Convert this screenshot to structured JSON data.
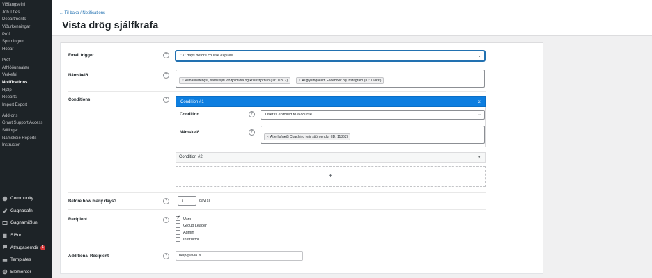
{
  "sidebar": {
    "submenu": [
      {
        "label": "Viðfangsefni",
        "active": false
      },
      {
        "label": "Job Titles",
        "active": false
      },
      {
        "label": "Departments",
        "active": false
      },
      {
        "label": "Viðurkenningar",
        "active": false
      },
      {
        "label": "Próf",
        "active": false
      },
      {
        "label": "Spurningum",
        "active": false
      },
      {
        "label": "Hópar",
        "active": false
      },
      {
        "label": "",
        "active": false
      },
      {
        "label": "Próf",
        "active": false
      },
      {
        "label": "Afhlöðunnalær",
        "active": false
      },
      {
        "label": "Verkefni",
        "active": false
      },
      {
        "label": "Notifications",
        "active": true
      },
      {
        "label": "Hjálp",
        "active": false
      },
      {
        "label": "Reports",
        "active": false
      },
      {
        "label": "Import Export",
        "active": false
      },
      {
        "label": "",
        "active": false
      },
      {
        "label": "Add-ons",
        "active": false
      },
      {
        "label": "Grant Support Access",
        "active": false
      },
      {
        "label": "Stillingar",
        "active": false
      },
      {
        "label": "Námskeið Reports",
        "active": false
      },
      {
        "label": "Instructor",
        "active": false
      }
    ],
    "menu": [
      {
        "label": "Community",
        "icon": "community-icon"
      },
      {
        "label": "Gagnasafn",
        "icon": "pin-icon"
      },
      {
        "label": "Gagnamiðlun",
        "icon": "media-icon"
      },
      {
        "label": "Síður",
        "icon": "page-icon"
      },
      {
        "label": "Athugasemdir",
        "icon": "comment-icon",
        "badge": "1"
      },
      {
        "label": "Templates",
        "icon": "folder-icon"
      },
      {
        "label": "Elementor",
        "icon": "elementor-icon"
      }
    ]
  },
  "header": {
    "back_link": "← Til baka / Notifications",
    "title": "Vista drög sjálfkrafa"
  },
  "form": {
    "help_glyph": "?",
    "email_trigger": {
      "label": "Email trigger",
      "value": "\"X\" days before course expires"
    },
    "courses": {
      "label": "Námskeið",
      "tags": [
        "Almannatengsl, samskipti við fjölmiðla og krísustjórnun (ID: 11872)",
        "Auglýsingakerfi Facebook og Instagram (ID: 11866)"
      ]
    },
    "conditions": {
      "label": "Conditions",
      "condition1": {
        "title": "Condition #1",
        "close": "×",
        "condition_label": "Condition",
        "condition_value": "User is enrolled to a course",
        "course_label": "Námskeið",
        "course_tags": [
          "Atferlisfræði Coaching fyrir stjórnendur (ID: 11862)"
        ]
      },
      "condition2": {
        "title": "Condition #2",
        "close": "×"
      },
      "add": "+"
    },
    "days": {
      "label": "Before how many days?",
      "value": "7",
      "unit": "day(s)"
    },
    "recipient": {
      "label": "Recipient",
      "options": [
        {
          "label": "User",
          "checked": true
        },
        {
          "label": "Group Leader",
          "checked": false
        },
        {
          "label": "Admin",
          "checked": false
        },
        {
          "label": "Instructor",
          "checked": false
        }
      ]
    },
    "additional_recipient": {
      "label": "Additional Recipient",
      "value": "help@avia.is"
    }
  },
  "colors": {
    "sidebar_bg": "#1d2327",
    "accent": "#2271b1",
    "condition_header": "#0d7ee0"
  }
}
